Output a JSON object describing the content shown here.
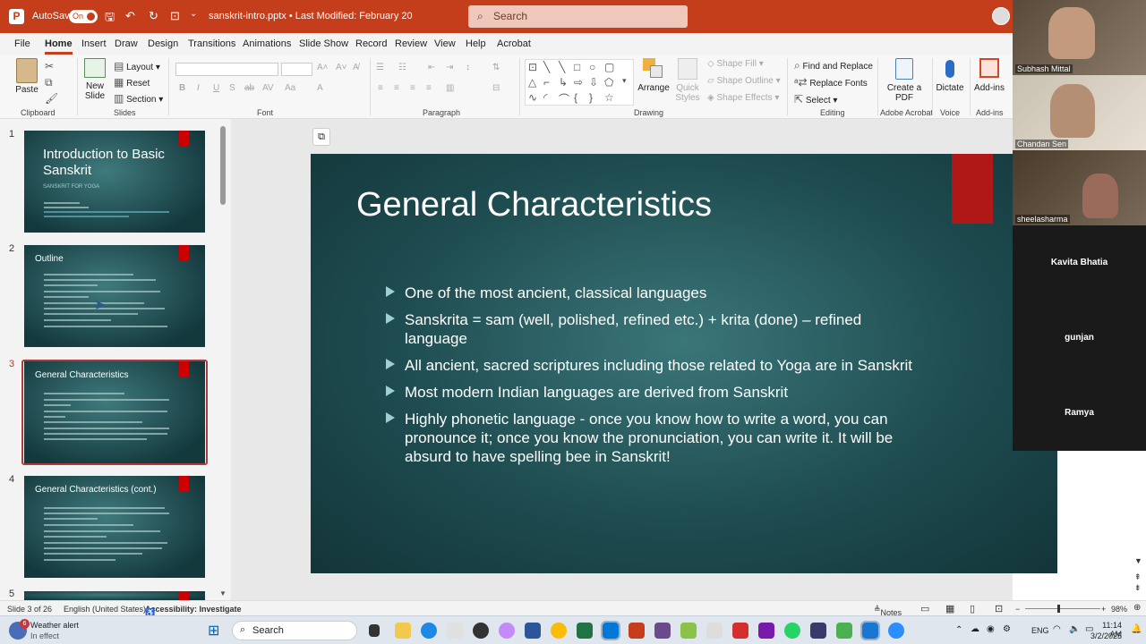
{
  "titlebar": {
    "autosave_label": "AutoSave",
    "autosave_state": "On",
    "filename": "sanskrit-intro.pptx • Last Modified: February 20",
    "search_placeholder": "Search"
  },
  "tabs": [
    "File",
    "Home",
    "Insert",
    "Draw",
    "Design",
    "Transitions",
    "Animations",
    "Slide Show",
    "Record",
    "Review",
    "View",
    "Help",
    "Acrobat"
  ],
  "ribbon": {
    "clipboard": {
      "paste": "Paste",
      "label": "Clipboard"
    },
    "slides": {
      "new_slide": "New Slide",
      "layout": "Layout",
      "reset": "Reset",
      "section": "Section",
      "label": "Slides"
    },
    "font": {
      "label": "Font"
    },
    "paragraph": {
      "label": "Paragraph"
    },
    "drawing": {
      "arrange": "Arrange",
      "quick_styles": "Quick Styles",
      "shape_fill": "Shape Fill",
      "shape_outline": "Shape Outline",
      "shape_effects": "Shape Effects",
      "label": "Drawing"
    },
    "editing": {
      "find_replace": "Find and Replace",
      "replace_fonts": "Replace Fonts",
      "select": "Select",
      "label": "Editing"
    },
    "acrobat": {
      "create_pdf": "Create a PDF",
      "label": "Adobe Acrobat"
    },
    "voice": {
      "dictate": "Dictate",
      "label": "Voice"
    },
    "addins": {
      "addins": "Add-ins",
      "label": "Add-ins"
    }
  },
  "thumbnails": [
    {
      "num": "1",
      "title": "Introduction to Basic Sanskrit",
      "subtitle": "SANSKRIT FOR YOGA"
    },
    {
      "num": "2",
      "title": "Outline"
    },
    {
      "num": "3",
      "title": "General Characteristics"
    },
    {
      "num": "4",
      "title": "General Characteristics (cont.)"
    },
    {
      "num": "5"
    }
  ],
  "slide": {
    "title": "General Characteristics",
    "bullets": [
      "One of the most ancient, classical languages",
      "Sanskrita = sam (well, polished, refined etc.) + krita (done) – refined language",
      "All ancient, sacred scriptures including those related to Yoga are in Sanskrit",
      "Most modern Indian languages are derived from Sanskrit",
      "Highly phonetic language - once you know how to write a word, you can pronounce it; once you know the pronunciation, you can write it. It will be absurd to have spelling bee in Sanskrit!"
    ]
  },
  "participants": [
    {
      "name": "Subhash Mittal"
    },
    {
      "name": "Chandan Sen"
    },
    {
      "name": "sheelasharma"
    },
    {
      "name": "Kavita Bhatia"
    },
    {
      "name": "gunjan"
    },
    {
      "name": "Ramya"
    }
  ],
  "status": {
    "slide_count": "Slide 3 of 26",
    "language": "English (United States)",
    "accessibility": "Accessibility: Investigate",
    "notes": "Notes",
    "zoom": "98%"
  },
  "taskbar": {
    "weather_title": "Weather alert",
    "weather_sub": "In effect",
    "weather_badge": "6",
    "search": "Search",
    "lang": "ENG",
    "time": "11:14 AM",
    "date": "3/2/2025"
  }
}
